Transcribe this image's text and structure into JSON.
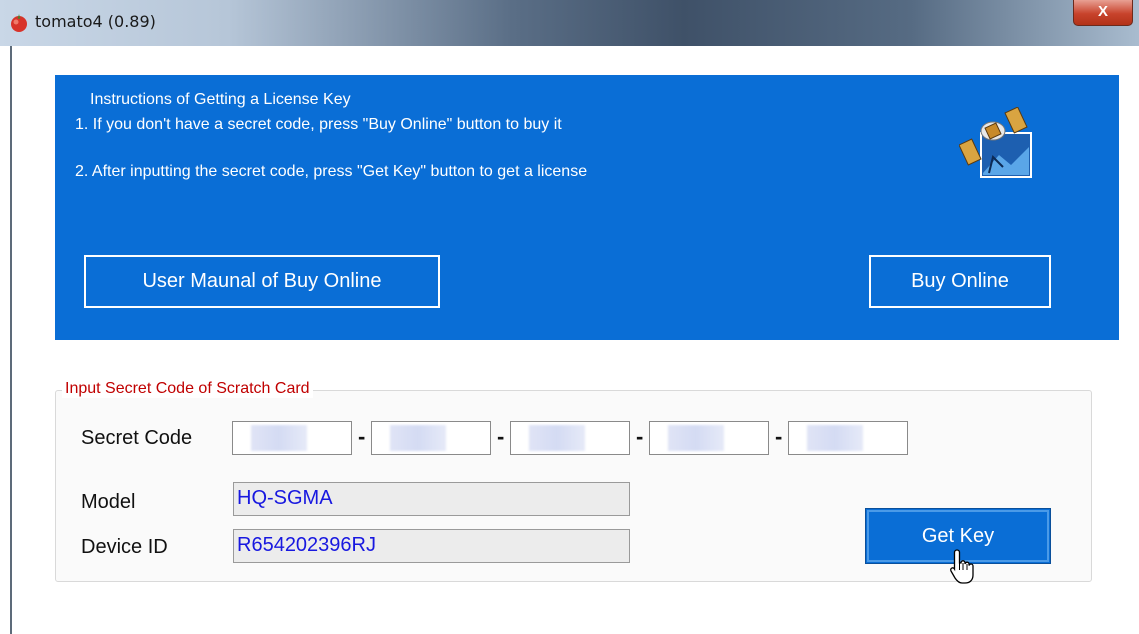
{
  "window": {
    "title": "tomato4 (0.89)",
    "close_label": "X",
    "app_icon": "tomato-icon"
  },
  "instructions": {
    "title": "Instructions of Getting a License Key",
    "step1": "1. If you don't have a secret code, press \"Buy Online\" button to buy it",
    "step2": "2. After inputting the secret code, press \"Get Key\" button to get a license",
    "illustration_icon": "satellite-icon"
  },
  "buttons": {
    "user_manual": "User Maunal of Buy Online",
    "buy_online": "Buy Online",
    "get_key": "Get Key"
  },
  "form": {
    "group_title": "Input Secret Code of Scratch Card",
    "secret_code_label": "Secret Code",
    "separator": "-",
    "model_label": "Model",
    "model_value": "HQ-SGMA",
    "device_id_label": "Device ID",
    "device_id_value": "R654202396RJ"
  },
  "colors": {
    "panel_blue": "#0a6ed6",
    "legend_red": "#c00000",
    "value_blue": "#1818e0"
  }
}
